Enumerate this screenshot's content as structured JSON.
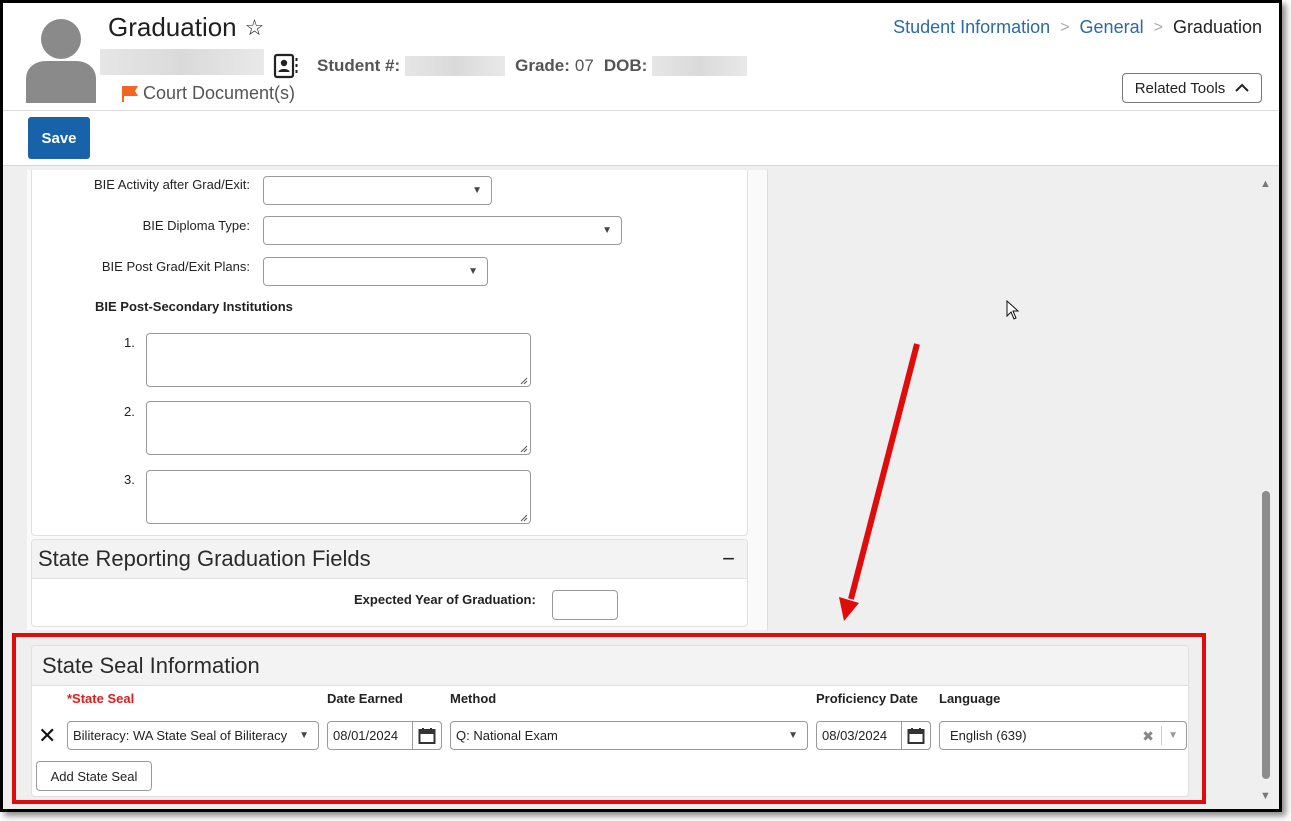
{
  "header": {
    "title": "Graduation",
    "favorite_icon": "star-outline-icon",
    "student_number_label": "Student #:",
    "grade_label": "Grade:",
    "grade_value": "07",
    "dob_label": "DOB:",
    "court_documents_label": "Court Document(s)",
    "related_tools_label": "Related Tools"
  },
  "breadcrumb": [
    {
      "label": "Student Information",
      "link": true
    },
    {
      "label": "General",
      "link": true
    },
    {
      "label": "Graduation",
      "link": false
    }
  ],
  "toolbar": {
    "save_label": "Save"
  },
  "bie_fields": {
    "activity_label": "BIE Activity after Grad/Exit:",
    "activity_value": "",
    "diploma_label": "BIE Diploma Type:",
    "diploma_value": "",
    "plans_label": "BIE Post Grad/Exit Plans:",
    "plans_value": "",
    "institutions_heading": "BIE Post-Secondary Institutions",
    "institutions": [
      {
        "number": "1.",
        "value": ""
      },
      {
        "number": "2.",
        "value": ""
      },
      {
        "number": "3.",
        "value": ""
      }
    ]
  },
  "state_reporting": {
    "title": "State Reporting Graduation Fields",
    "collapse_symbol": "−",
    "expected_year_label": "Expected Year of Graduation:",
    "expected_year_value": ""
  },
  "state_seal": {
    "title": "State Seal Information",
    "columns": {
      "state_seal": "*State Seal",
      "date_earned": "Date Earned",
      "method": "Method",
      "proficiency_date": "Proficiency Date",
      "language": "Language"
    },
    "rows": [
      {
        "state_seal": "Biliteracy: WA State Seal of Biliteracy",
        "date_earned": "08/01/2024",
        "method": "Q: National Exam",
        "proficiency_date": "08/03/2024",
        "language": "English (639)"
      }
    ],
    "add_button_label": "Add State Seal"
  },
  "colors": {
    "primary": "#1762a8",
    "link": "#2a6aa6",
    "required": "#e31b1b",
    "annotation": "#e00b0b",
    "flag": "#f26522"
  }
}
